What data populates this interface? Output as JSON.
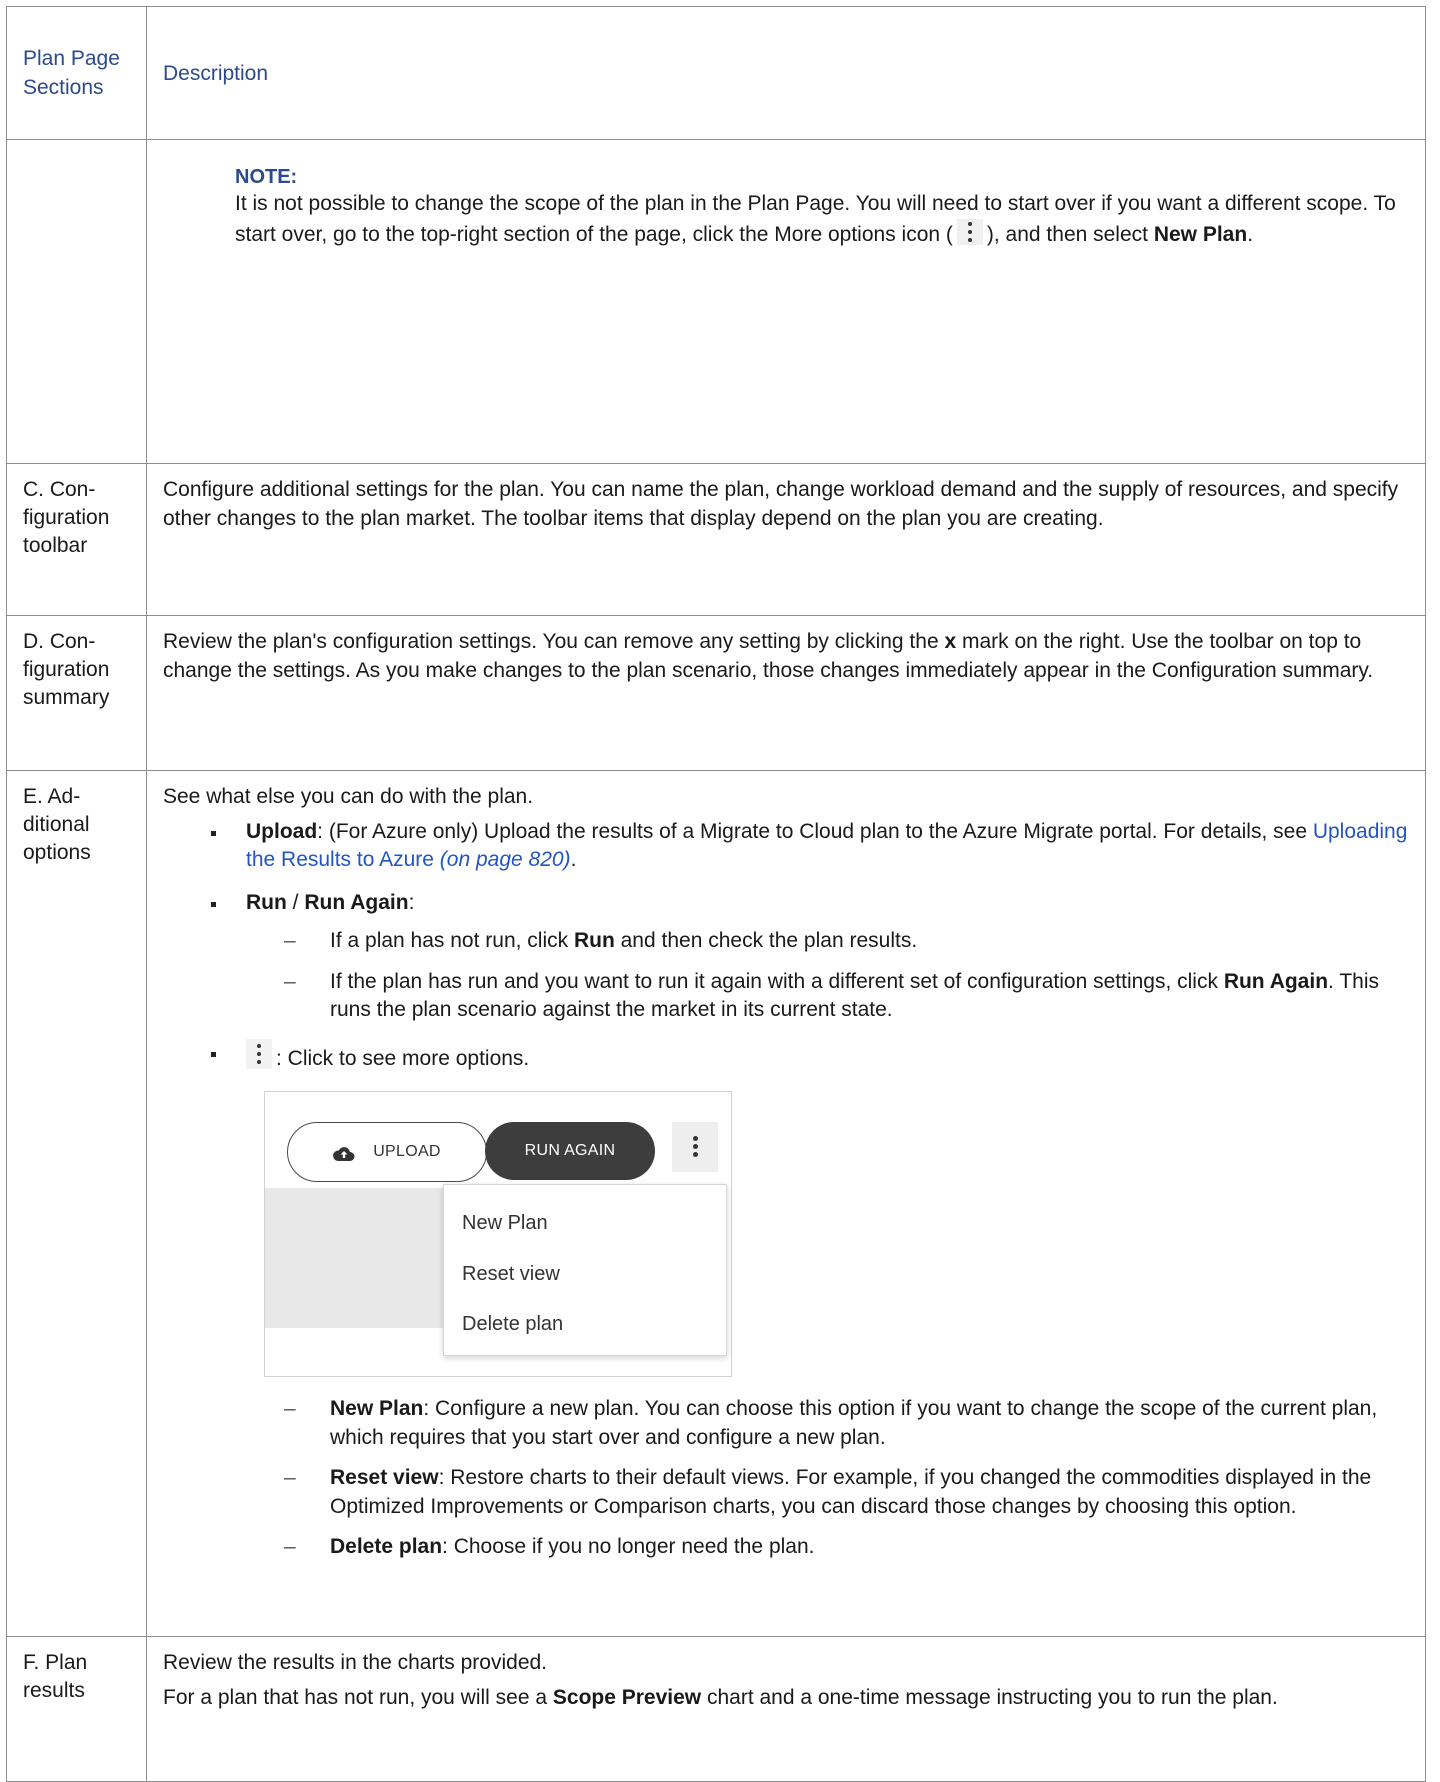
{
  "header": {
    "col1": "Plan Page Sections",
    "col2": "Description"
  },
  "note_row": {
    "label": "NOTE:",
    "text_before": "It is not possible to change the scope of the plan in the Plan Page. You will need to start over if you want a different scope. To start over, go to the top-right section of the page, click the More options icon (",
    "text_middle": "), and then select ",
    "bold_new_plan": "New Plan",
    "text_end": ".",
    "icon": "more-options-kebab-icon"
  },
  "row_c": {
    "section": "C. Con-figuration toolbar",
    "section_lines": [
      "C. Con-",
      "figuration",
      "toolbar"
    ],
    "description": "Configure additional settings for the plan. You can name the plan, change workload demand and the supply of resources, and specify other changes to the plan market. The toolbar items that display depend on the plan you are creating."
  },
  "row_d": {
    "section_lines": [
      "D. Con-",
      "figuration",
      "summary"
    ],
    "desc_before": "Review the plan's configuration settings. You can remove any setting by clicking the ",
    "desc_bold": "x",
    "desc_after": " mark on the right. Use the toolbar on top to change the settings. As you make changes to the plan scenario, those changes immediately appear in the Configuration summary."
  },
  "row_e": {
    "section_lines": [
      "E. Ad-",
      "ditional",
      "options"
    ],
    "intro": "See what else you can do with the plan.",
    "upload": {
      "label": "Upload",
      "text": ": (For Azure only) Upload the results of a Migrate to Cloud plan to the Azure Migrate portal. For details, see ",
      "link": "Uploading the Results to Azure",
      "link_page": "(on page 820)",
      "end": "."
    },
    "run": {
      "label_run": "Run",
      "separator": " / ",
      "label_run_again": "Run Again",
      "colon": ":",
      "sub1_before": "If a plan has not run, click ",
      "sub1_bold": "Run",
      "sub1_after": " and then check the plan results.",
      "sub2_before": "If the plan has run and you want to run it again with a different set of configuration settings, click ",
      "sub2_bold": "Run Again",
      "sub2_after": ". This runs the plan scenario against the market in its current state."
    },
    "more": {
      "text": ": Click to see more options.",
      "icon": "more-options-kebab-icon"
    },
    "screenshot": {
      "upload_button": "UPLOAD",
      "run_again_button": "RUN AGAIN",
      "menu_items": [
        "New Plan",
        "Reset view",
        "Delete plan"
      ],
      "upload_icon": "cloud-upload-icon"
    },
    "options": [
      {
        "label": "New Plan",
        "text": ": Configure a new plan. You can choose this option if you want to change the scope of the current plan, which requires that you start over and configure a new plan."
      },
      {
        "label": "Reset view",
        "text": ": Restore charts to their default views. For example, if you changed the commodities displayed in the Optimized Improvements or Comparison charts, you can discard those changes by choosing this option."
      },
      {
        "label": "Delete plan",
        "text": ": Choose if you no longer need the plan."
      }
    ]
  },
  "row_f": {
    "section_lines": [
      "F. Plan",
      "results"
    ],
    "p1": "Review the results in the charts provided.",
    "p2_before": "For a plan that has not run, you will see a ",
    "p2_bold": "Scope Preview",
    "p2_after": " chart and a one-time message instructing you to run the plan."
  },
  "colors": {
    "heading_blue": "#2b4a8f",
    "link_blue": "#2255c4",
    "border": "#8c8c8c"
  }
}
